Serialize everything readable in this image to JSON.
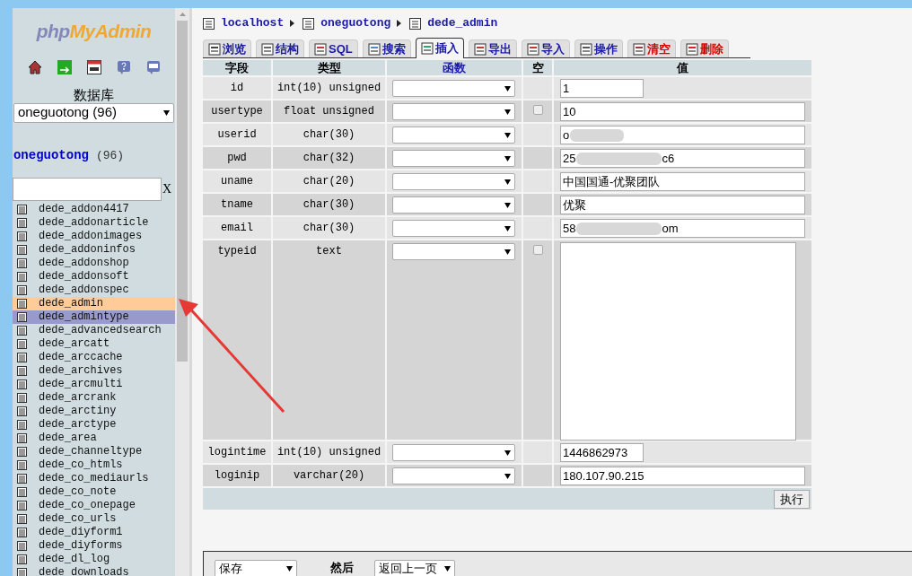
{
  "sidebar": {
    "logo": {
      "part1": "php",
      "part2": "MyAdmin"
    },
    "db_label": "数据库",
    "db_select": "oneguotong (96)",
    "db_title": "oneguotong",
    "db_count": "(96)",
    "filter_clear": "X",
    "tables": [
      {
        "name": "dede_addon4417",
        "hovered": false,
        "marked": false
      },
      {
        "name": "dede_addonarticle",
        "hovered": false,
        "marked": false
      },
      {
        "name": "dede_addonimages",
        "hovered": false,
        "marked": false
      },
      {
        "name": "dede_addoninfos",
        "hovered": false,
        "marked": false
      },
      {
        "name": "dede_addonshop",
        "hovered": false,
        "marked": false
      },
      {
        "name": "dede_addonsoft",
        "hovered": false,
        "marked": false
      },
      {
        "name": "dede_addonspec",
        "hovered": false,
        "marked": false
      },
      {
        "name": "dede_admin",
        "hovered": true,
        "marked": false
      },
      {
        "name": "dede_admintype",
        "hovered": false,
        "marked": true
      },
      {
        "name": "dede_advancedsearch",
        "hovered": false,
        "marked": false
      },
      {
        "name": "dede_arcatt",
        "hovered": false,
        "marked": false
      },
      {
        "name": "dede_arccache",
        "hovered": false,
        "marked": false
      },
      {
        "name": "dede_archives",
        "hovered": false,
        "marked": false
      },
      {
        "name": "dede_arcmulti",
        "hovered": false,
        "marked": false
      },
      {
        "name": "dede_arcrank",
        "hovered": false,
        "marked": false
      },
      {
        "name": "dede_arctiny",
        "hovered": false,
        "marked": false
      },
      {
        "name": "dede_arctype",
        "hovered": false,
        "marked": false
      },
      {
        "name": "dede_area",
        "hovered": false,
        "marked": false
      },
      {
        "name": "dede_channeltype",
        "hovered": false,
        "marked": false
      },
      {
        "name": "dede_co_htmls",
        "hovered": false,
        "marked": false
      },
      {
        "name": "dede_co_mediaurls",
        "hovered": false,
        "marked": false
      },
      {
        "name": "dede_co_note",
        "hovered": false,
        "marked": false
      },
      {
        "name": "dede_co_onepage",
        "hovered": false,
        "marked": false
      },
      {
        "name": "dede_co_urls",
        "hovered": false,
        "marked": false
      },
      {
        "name": "dede_diyform1",
        "hovered": false,
        "marked": false
      },
      {
        "name": "dede_diyforms",
        "hovered": false,
        "marked": false
      },
      {
        "name": "dede_dl_log",
        "hovered": false,
        "marked": false
      },
      {
        "name": "dede_downloads",
        "hovered": false,
        "marked": false
      }
    ]
  },
  "breadcrumb": [
    "localhost",
    "oneguotong",
    "dede_admin"
  ],
  "tabs": [
    {
      "label": "浏览",
      "selected": false,
      "kind": "normal"
    },
    {
      "label": "结构",
      "selected": false,
      "kind": "normal"
    },
    {
      "label": "SQL",
      "selected": false,
      "kind": "normal"
    },
    {
      "label": "搜索",
      "selected": false,
      "kind": "normal"
    },
    {
      "label": "插入",
      "selected": true,
      "kind": "normal"
    },
    {
      "label": "导出",
      "selected": false,
      "kind": "normal"
    },
    {
      "label": "导入",
      "selected": false,
      "kind": "normal"
    },
    {
      "label": "操作",
      "selected": false,
      "kind": "normal"
    },
    {
      "label": "清空",
      "selected": false,
      "kind": "danger"
    },
    {
      "label": "删除",
      "selected": false,
      "kind": "danger"
    }
  ],
  "table": {
    "columns": [
      "字段",
      "类型",
      "函数",
      "空",
      "值"
    ],
    "rows": [
      {
        "field": "id",
        "type": "int(10) unsigned",
        "nullable": false,
        "kind": "short",
        "value": "1"
      },
      {
        "field": "usertype",
        "type": "float unsigned",
        "nullable": true,
        "null_checked": false,
        "kind": "input",
        "value": "10"
      },
      {
        "field": "userid",
        "type": "char(30)",
        "nullable": false,
        "kind": "input",
        "value": "o",
        "redacted": true
      },
      {
        "field": "pwd",
        "type": "char(32)",
        "nullable": false,
        "kind": "input",
        "value": "25",
        "redacted": true,
        "value_end": "c6"
      },
      {
        "field": "uname",
        "type": "char(20)",
        "nullable": false,
        "kind": "input",
        "value": "中国国通-优聚团队"
      },
      {
        "field": "tname",
        "type": "char(30)",
        "nullable": false,
        "kind": "input",
        "value": "优聚"
      },
      {
        "field": "email",
        "type": "char(30)",
        "nullable": false,
        "kind": "input",
        "value": "58",
        "redacted": true,
        "value_end": "om"
      },
      {
        "field": "typeid",
        "type": "text",
        "nullable": true,
        "null_checked": false,
        "kind": "textarea"
      },
      {
        "field": "logintime",
        "type": "int(10) unsigned",
        "nullable": false,
        "kind": "short",
        "value": "1446862973"
      },
      {
        "field": "loginip",
        "type": "varchar(20)",
        "nullable": false,
        "kind": "input",
        "value": "180.107.90.215"
      }
    ],
    "submit": "执行"
  },
  "footer": {
    "action": "保存",
    "then": "然后",
    "after": "返回上一页"
  }
}
